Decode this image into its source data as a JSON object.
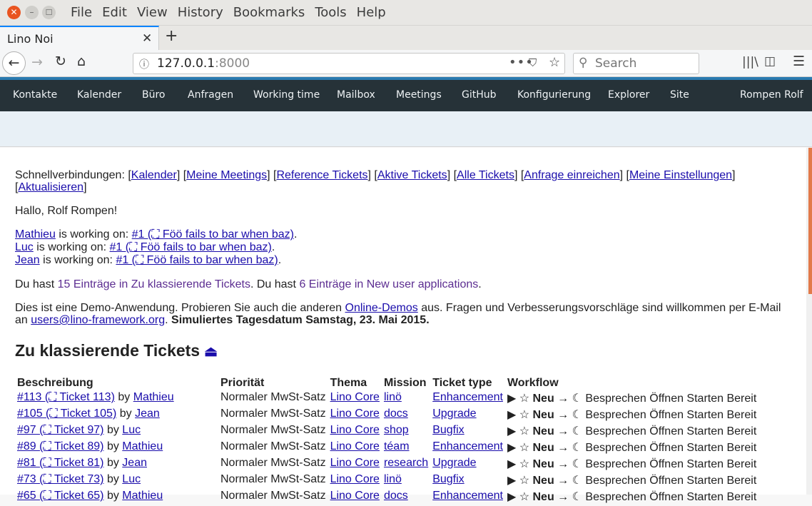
{
  "os": {
    "menu": [
      "File",
      "Edit",
      "View",
      "History",
      "Bookmarks",
      "Tools",
      "Help"
    ]
  },
  "browser": {
    "tab_title": "Lino Noi",
    "url_host": "127.0.0.1",
    "url_port": ":8000",
    "search_placeholder": "Search"
  },
  "appnav": {
    "items": [
      "Kontakte",
      "Kalender",
      "Büro",
      "Anfragen",
      "Working time",
      "Mailbox",
      "Meetings",
      "GitHub",
      "Konfigurierung",
      "Explorer",
      "Site"
    ],
    "user": "Rompen Rolf"
  },
  "quicklinks": {
    "label": "Schnellverbindungen:",
    "links": [
      "Kalender",
      "Meine Meetings",
      "Reference Tickets",
      "Aktive Tickets",
      "Alle Tickets",
      "Anfrage einreichen",
      "Meine Einstellungen"
    ],
    "refresh": "Aktualisieren"
  },
  "greeting": "Hallo, Rolf Rompen!",
  "working": [
    {
      "user": "Mathieu",
      "text": "is working on:",
      "ticket": "#1 (⛶ Föö fails to bar when baz)"
    },
    {
      "user": "Luc",
      "text": "is working on:",
      "ticket": "#1 (⛶ Föö fails to bar when baz)"
    },
    {
      "user": "Jean",
      "text": "is working on:",
      "ticket": "#1 (⛶ Föö fails to bar when baz)"
    }
  ],
  "summary": {
    "p1": "Du hast",
    "link1": "15 Einträge in Zu klassierende Tickets",
    "p2": ". Du hast",
    "link2": "6 Einträge in New user applications",
    "p3": "."
  },
  "demo": {
    "text1": "Dies ist eine Demo-Anwendung. Probieren Sie auch die anderen",
    "link1": "Online-Demos",
    "text2": "aus. Fragen und Verbesserungsvorschläge sind willkommen per E-Mail",
    "text3": "an",
    "email": "users@lino-framework.org",
    "text4": ".",
    "sim": "Simuliertes Tagesdatum Samstag, 23. Mai 2015."
  },
  "section_title": "Zu klassierende Tickets",
  "table": {
    "headers": [
      "Beschreibung",
      "Priorität",
      "Thema",
      "Mission",
      "Ticket type",
      "Workflow"
    ],
    "rows": [
      {
        "ticket": "#113 (⛶ Ticket 113)",
        "by": "by",
        "user": "Mathieu",
        "prio": "Normaler MwSt-Satz",
        "topic": "Lino Core",
        "mission": "linö",
        "type": "Enhancement",
        "wf_pre": "▶ ☆",
        "wf_state": "Neu",
        "wf_post": "→ ☾ Besprechen Öffnen Starten Bereit"
      },
      {
        "ticket": "#105 (⛶ Ticket 105)",
        "by": "by",
        "user": "Jean",
        "prio": "Normaler MwSt-Satz",
        "topic": "Lino Core",
        "mission": "docs",
        "type": "Upgrade",
        "wf_pre": "▶ ☆",
        "wf_state": "Neu",
        "wf_post": "→ ☾ Besprechen Öffnen Starten Bereit"
      },
      {
        "ticket": "#97 (⛶ Ticket 97)",
        "by": "by",
        "user": "Luc",
        "prio": "Normaler MwSt-Satz",
        "topic": "Lino Core",
        "mission": "shop",
        "type": "Bugfix",
        "wf_pre": "▶ ☆",
        "wf_state": "Neu",
        "wf_post": "→ ☾ Besprechen Öffnen Starten Bereit"
      },
      {
        "ticket": "#89 (⛶ Ticket 89)",
        "by": "by",
        "user": "Mathieu",
        "prio": "Normaler MwSt-Satz",
        "topic": "Lino Core",
        "mission": "téam",
        "type": "Enhancement",
        "wf_pre": "▶ ☆",
        "wf_state": "Neu",
        "wf_post": "→ ☾ Besprechen Öffnen Starten Bereit"
      },
      {
        "ticket": "#81 (⛶ Ticket 81)",
        "by": "by",
        "user": "Jean",
        "prio": "Normaler MwSt-Satz",
        "topic": "Lino Core",
        "mission": "research",
        "type": "Upgrade",
        "wf_pre": "▶ ☆",
        "wf_state": "Neu",
        "wf_post": "→ ☾ Besprechen Öffnen Starten Bereit"
      },
      {
        "ticket": "#73 (⛶ Ticket 73)",
        "by": "by",
        "user": "Luc",
        "prio": "Normaler MwSt-Satz",
        "topic": "Lino Core",
        "mission": "linö",
        "type": "Bugfix",
        "wf_pre": "▶ ☆",
        "wf_state": "Neu",
        "wf_post": "→ ☾ Besprechen Öffnen Starten Bereit"
      },
      {
        "ticket": "#65 (⛶ Ticket 65)",
        "by": "by",
        "user": "Mathieu",
        "prio": "Normaler MwSt-Satz",
        "topic": "Lino Core",
        "mission": "docs",
        "type": "Enhancement",
        "wf_pre": "▶ ☆",
        "wf_state": "Neu",
        "wf_post": "→ ☾ Besprechen Öffnen Starten Bereit"
      }
    ]
  }
}
